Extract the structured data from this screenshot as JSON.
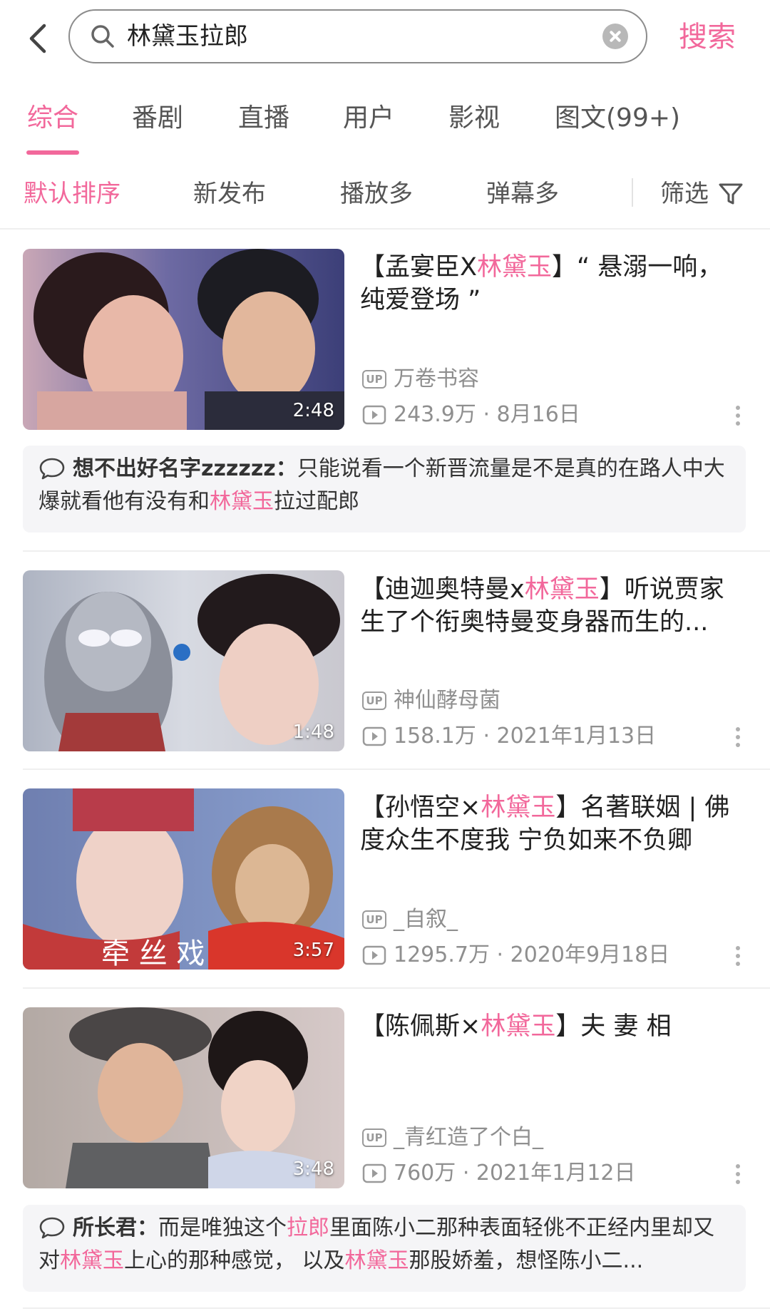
{
  "search": {
    "query": "林黛玉拉郎",
    "button": "搜索"
  },
  "tabs": [
    "综合",
    "番剧",
    "直播",
    "用户",
    "影视",
    "图文(99+)"
  ],
  "sort": {
    "options": [
      "默认排序",
      "新发布",
      "播放多",
      "弹幕多"
    ],
    "filter": "筛选"
  },
  "colors": {
    "accent": "#f2689b",
    "text": "#212121",
    "muted": "#8f8f8f"
  },
  "results": [
    {
      "title_parts": [
        "【孟宴臣X",
        "林黛玉",
        "】“ 悬溺一响，纯爱登场 ”"
      ],
      "duration": "2:48",
      "up": "万卷书容",
      "views": "243.9万",
      "date": "8月16日",
      "comment": {
        "user": "想不出好名字zzzzzz：",
        "parts": [
          "只能说看一个新晋流量是不是真的在路人中大爆就看他有没有和",
          "林黛玉",
          "拉过配郎"
        ]
      }
    },
    {
      "title_parts": [
        "【迪迦奥特曼x",
        "林黛玉",
        "】听说贾家生了个衔奥特曼变身器而生的..."
      ],
      "duration": "1:48",
      "up": "神仙酵母菌",
      "views": "158.1万",
      "date": "2021年1月13日"
    },
    {
      "title_parts": [
        "【孙悟空×",
        "林黛玉",
        "】名著联姻 | 佛度众生不度我 宁负如来不负卿"
      ],
      "duration": "3:57",
      "up": "_自叙_",
      "views": "1295.7万",
      "date": "2020年9月18日"
    },
    {
      "title_parts": [
        "【陈佩斯×",
        "林黛玉",
        "】夫 妻 相"
      ],
      "duration": "3:48",
      "up": "_青红造了个白_",
      "views": "760万",
      "date": "2021年1月12日",
      "comment": {
        "user": "所长君：",
        "parts": [
          "而是唯独这个",
          "拉郎",
          "里面陈小二那种表面轻佻不正经内里却又对",
          "林黛玉",
          "上心的那种感觉， 以及",
          "林黛玉",
          "那股娇羞，想怪陈小二..."
        ]
      }
    }
  ],
  "labels": {
    "up_badge": "UP",
    "dot": "·"
  }
}
